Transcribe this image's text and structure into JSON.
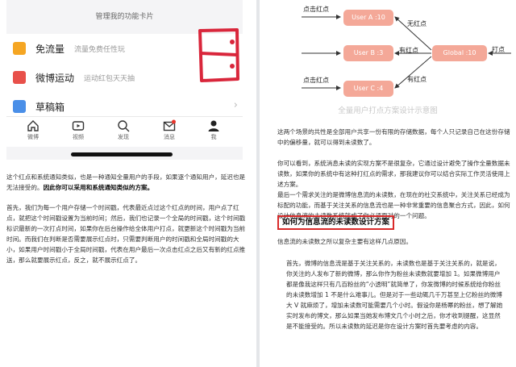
{
  "left_page": {
    "phone": {
      "header_title": "管理我的功能卡片",
      "cards": [
        {
          "name": "免流量",
          "sub": "流量免费任性玩",
          "icon": "sim-card-icon",
          "color": "#f5a623"
        },
        {
          "name": "微博运动",
          "sub": "运动红包天天抽",
          "icon": "sneaker-icon",
          "color": "#e8504a"
        },
        {
          "name": "草稿箱",
          "sub": "",
          "icon": "draft-box-icon",
          "color": "#4a8fe8"
        }
      ],
      "chevron": "›",
      "tabs": [
        {
          "label": "微博",
          "icon": "home-icon"
        },
        {
          "label": "视频",
          "icon": "video-icon"
        },
        {
          "label": "发现",
          "icon": "search-icon"
        },
        {
          "label": "消息",
          "icon": "mail-icon"
        },
        {
          "label": "我",
          "icon": "profile-icon"
        }
      ]
    },
    "para1_a": "这个红点和系统通知类似，也是一种通知全量用户的手段，如果逐个通知用户，延迟也是无法接受的。",
    "para1_b": "因此你可以采用和系统通知类似的方案。",
    "para2": "首先，我们为每一个用户存储一个时间戳，代表最近点过这个红点的时间，用户点了红点，就把这个时间戳设置为当前时间；然后，我们也记录一个全局的时间戳，这个时间戳标识最新的一次打点时间，如果你在后台操作给全体用户打点，就更新这个时间戳为当前时间。而我们在判断是否需要展示红点时，只需要判断用户的时间戳和全局时间戳的大小，如果用户时间戳小于全局时间戳，代表在用户最后一次点击红点之后又有新的红点推送，那么就要展示红点，反之，就不展示红点了。"
  },
  "right_page": {
    "diagram": {
      "users": [
        "User A :10",
        "User B :3",
        "User C :4"
      ],
      "global_node": "Global :10",
      "left_labels": [
        "点击红点",
        "点击红点"
      ],
      "edge_labels": [
        "无红点",
        "有红点",
        "有红点"
      ],
      "right_label": "打点",
      "caption": "全量用户打点方案设计示意图"
    },
    "para1": "这两个场景的共性是全部用户共享一份有限的存储数据，每个人只记录自己在这份存储中的偏移量，就可以得到未读数了。",
    "para2": "你可以看到，系统消息未读的实现方案不是很复杂，它通过设计避免了操作全量数据未读数，如果你的系统中有这种打红点的需求，那我建议你可以结合实际工作灵活使用上述方案。",
    "para3": "最后一个需求关注的是微博信息流的未读数，在现在的社交系统中，关注关系已经成为标配的功能，而基于关注关系的信息流也是一种非常重要的信息聚合方式，因此，如何设计信息流的未读数系统就成了你必须面对的一个问题。",
    "heading": "如何为信息流的未读数设计方案",
    "para4": "信息流的未读数之所以复杂主要有这样几点原因。",
    "para5": "首先，微博的信息流是基于关注关系的，未读数也是基于关注关系的，就是说，你关注的人发布了新的微博，那么你作为粉丝未读数就要增加 1。如果微博用户都是像我这样只有几百粉丝的“小透明”就简单了，你发微博的时候系统给你粉丝的未读数增加 1 不是什么难事儿。但是对于一些动辄几千万甚至上亿粉丝的微博大 V 就麻烦了，增加未读数可能需要几个小时。假设你是杨幂的粉丝，想了解她实时发布的博文，那么如果当她发布博文几个小时之后，你才收到提醒，这显然是不能接受的。所以未读数的延迟是你在设计方案时首先要考虑的内容。"
  }
}
